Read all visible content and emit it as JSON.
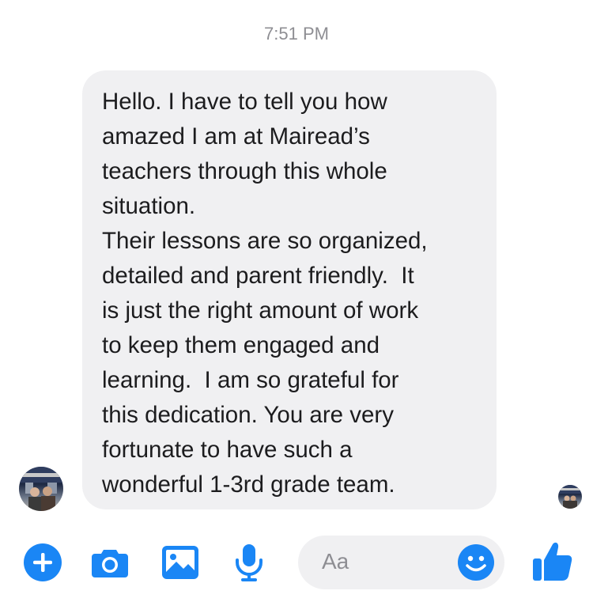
{
  "thread": {
    "timestamp": "7:51 PM",
    "message": {
      "text": "Hello. I have to tell you how\namazed I am at Mairead’s\nteachers through this whole\nsituation.\nTheir lessons are so organized,\ndetailed and parent friendly.  It\nis just the right amount of work\nto keep them engaged and\nlearning.  I am so grateful for\nthis dedication. You are very\nfortunate to have such a\nwonderful 1-3rd grade team."
    }
  },
  "composer": {
    "placeholder": "Aa",
    "icons": [
      "plus-icon",
      "camera-icon",
      "gallery-icon",
      "microphone-icon",
      "emoji-icon",
      "thumbs-up-icon"
    ]
  },
  "colors": {
    "accent": "#1a86f5",
    "bubble": "#f0f0f2",
    "text": "#1c1c1e",
    "muted": "#8e8e93"
  }
}
